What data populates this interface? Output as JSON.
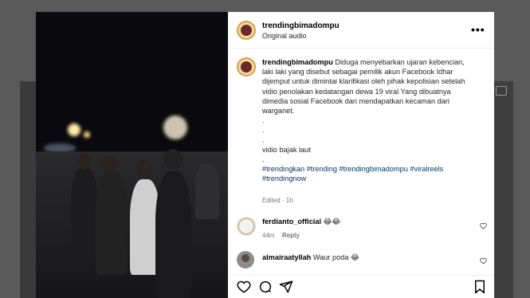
{
  "post": {
    "username": "trendingbimadompu",
    "audio": "Original audio",
    "more_label": "•••",
    "caption_lines": [
      "Diduga menyebarkan ujaran kebencian,",
      "laki laki yang disebut sebagai pemilik akun Facebook Idhar",
      "dijemput untuk dimintai klarifikasi oleh pihak kepolisian setelah",
      "vidio penolakan kedatangan dewa 19 viral Yang dibuatnya",
      "dimedia sosial Facebook dan mendapatkan kecaman dari",
      "warganet."
    ],
    "dots": [
      ".",
      ".",
      "."
    ],
    "line_bajak": "vidio bajak laut",
    "dots2": [
      "."
    ],
    "hashtags_line1": "#trendingkan #trending #trendingbimadompu #viralreels",
    "hashtags_line2": "#trendingnow",
    "edited": "Edited · 1h"
  },
  "comments": [
    {
      "username": "ferdianto_official",
      "text": "😂😂",
      "time": "44m",
      "reply": "Reply"
    },
    {
      "username": "almairaatyllah",
      "text": "Waur poda 😂",
      "partial_meta": ""
    }
  ],
  "icons": {
    "like": "heart-icon",
    "comment": "comment-icon",
    "share": "share-icon",
    "save": "bookmark-icon",
    "comment_like": "heart-icon"
  }
}
